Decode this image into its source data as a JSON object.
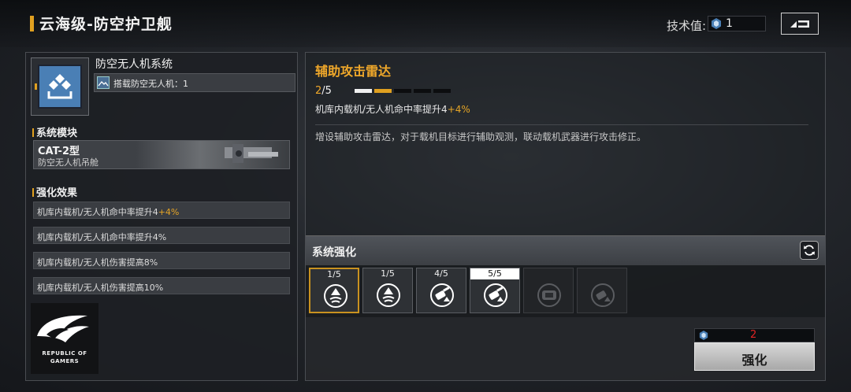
{
  "header": {
    "title": "云海级-防空护卫舰",
    "tech_label": "技术值:",
    "tech_value": "1"
  },
  "system": {
    "name": "防空无人机系统",
    "sub_text": "搭载防空无人机：1"
  },
  "module": {
    "section_title": "系统模块",
    "name": "CAT-2型",
    "desc": "防空无人机吊舱"
  },
  "effects": {
    "section_title": "强化效果",
    "rows": [
      {
        "text": "机库内载机/无人机命中率提升4",
        "bonus": "+4%"
      },
      {
        "text": "机库内载机/无人机命中率提升4%",
        "bonus": ""
      },
      {
        "text": "机库内载机/无人机伤害提高8%",
        "bonus": ""
      },
      {
        "text": "机库内载机/无人机伤害提高10%",
        "bonus": ""
      }
    ]
  },
  "logo": {
    "line1": "REPUBLIC OF",
    "line2": "GAMERS"
  },
  "detail": {
    "title": "辅助攻击雷达",
    "progress_cur": "2",
    "progress_max": "/5",
    "progress_level": 2,
    "effect_text": "机库内载机/无人机命中率提升4",
    "effect_bonus": "+4%",
    "description": "增设辅助攻击雷达，对于载机目标进行辅助观测，联动载机武器进行攻击修正。"
  },
  "enhance": {
    "title": "系统强化",
    "slots": [
      {
        "count": "1/5",
        "icon": "drone-up-icon",
        "state": "active"
      },
      {
        "count": "1/5",
        "icon": "drone-up-icon",
        "state": "normal"
      },
      {
        "count": "4/5",
        "icon": "gun-up-icon",
        "state": "normal"
      },
      {
        "count": "5/5",
        "icon": "gun-up-icon",
        "state": "max"
      },
      {
        "count": "",
        "icon": "armor-locked-icon",
        "state": "locked"
      },
      {
        "count": "",
        "icon": "gun-locked-icon",
        "state": "locked"
      }
    ],
    "cost_value": "2",
    "upgrade_label": "强化"
  },
  "colors": {
    "accent": "#e0a020",
    "highlight": "#e6a526",
    "cost_red": "#e02424",
    "icon_blue": "#4a7fb5"
  }
}
